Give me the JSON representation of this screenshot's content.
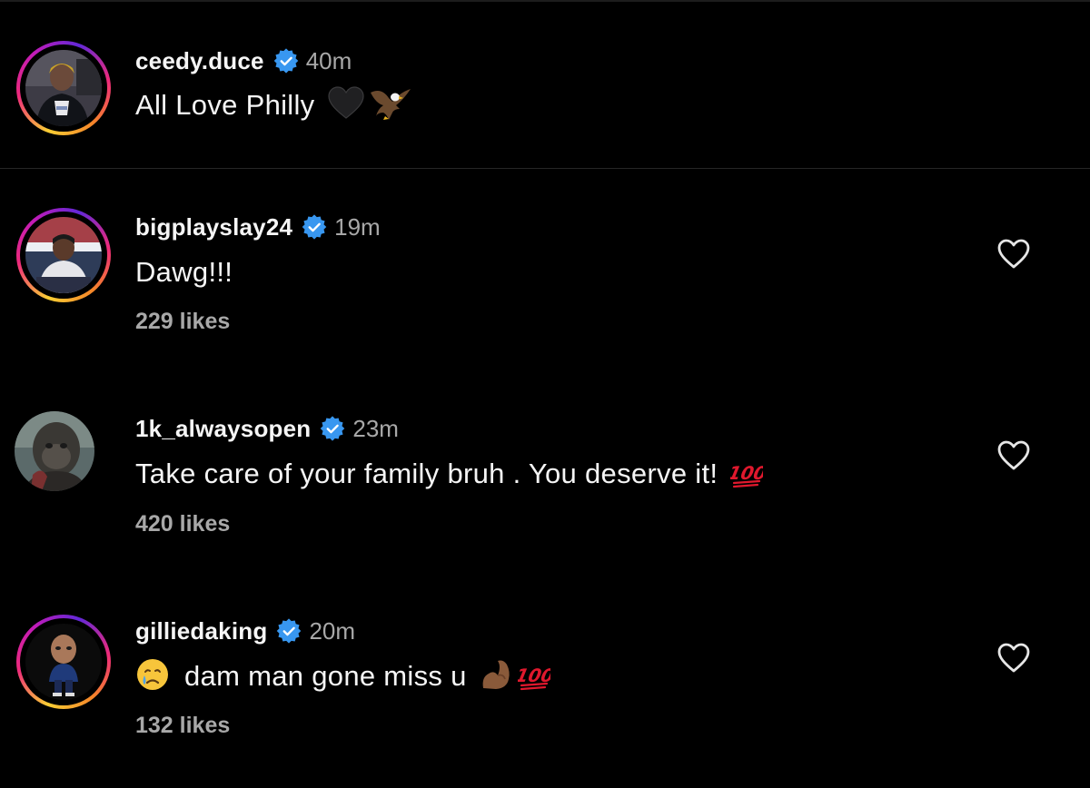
{
  "caption": {
    "username": "ceedy.duce",
    "time": "40m",
    "text": "All Love Philly",
    "emoji": [
      "black-heart",
      "eagle"
    ]
  },
  "comments": [
    {
      "username": "bigplayslay24",
      "time": "19m",
      "text": "Dawg!!!",
      "likes": "229 likes"
    },
    {
      "username": "1k_alwaysopen",
      "time": "23m",
      "text": "Take care of your family bruh . You deserve it!",
      "emoji": [
        "hundred-points"
      ],
      "likes": "420 likes"
    },
    {
      "username": "gilliedaking",
      "time": "20m",
      "text": "dam man gone miss u",
      "emoji_before": [
        "crying-face"
      ],
      "emoji": [
        "flexed-biceps",
        "hundred-points"
      ],
      "likes": "132 likes"
    }
  ],
  "colors": {
    "background": "#000000",
    "text": "#f5f5f5",
    "secondary": "#a8a8a8",
    "verified": "#3897f0",
    "divider": "#262626"
  }
}
